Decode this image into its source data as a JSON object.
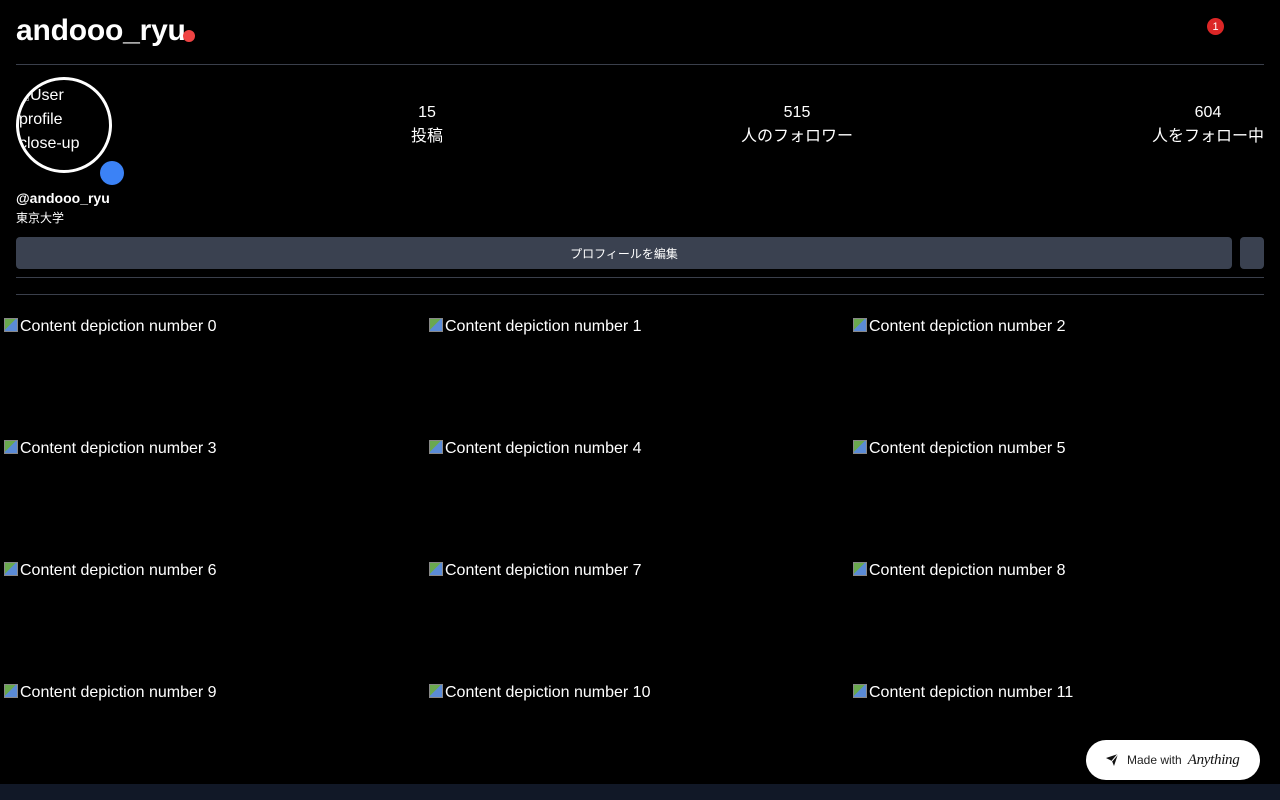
{
  "header": {
    "username": "andooo_ryu",
    "notification_count": "1"
  },
  "profile": {
    "avatar_alt": "User profile close-up ph",
    "handle": "@andooo_ryu",
    "bio": "東京大学",
    "stats": [
      {
        "value": "15",
        "label": "投稿"
      },
      {
        "value": "515",
        "label": "人のフォロワー"
      },
      {
        "value": "604",
        "label": "人をフォロー中"
      }
    ],
    "edit_label": "プロフィールを編集"
  },
  "posts": [
    "Content depiction number 0",
    "Content depiction number 1",
    "Content depiction number 2",
    "Content depiction number 3",
    "Content depiction number 4",
    "Content depiction number 5",
    "Content depiction number 6",
    "Content depiction number 7",
    "Content depiction number 8",
    "Content depiction number 9",
    "Content depiction number 10",
    "Content depiction number 11"
  ],
  "badge": {
    "made_with": "Made with",
    "brand": "Anything"
  },
  "colors": {
    "live_dot": "#ef4444",
    "online_dot": "#3b82f6",
    "notification_badge": "#dc2626",
    "button_bg": "#3a4150"
  }
}
